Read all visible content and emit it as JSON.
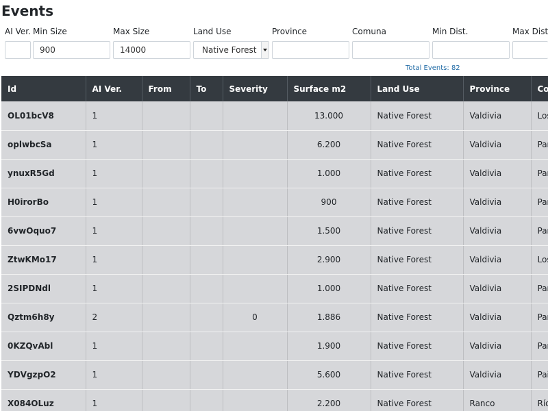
{
  "page": {
    "title": "Events"
  },
  "filters": {
    "ai_ver": {
      "label": "AI Ver.",
      "value": ""
    },
    "min_size": {
      "label": "Min Size",
      "value": "900"
    },
    "max_size": {
      "label": "Max Size",
      "value": "14000"
    },
    "land_use": {
      "label": "Land Use",
      "value": "Native Forest"
    },
    "province": {
      "label": "Province",
      "value": ""
    },
    "comuna": {
      "label": "Comuna",
      "value": ""
    },
    "min_dist": {
      "label": "Min Dist.",
      "value": ""
    },
    "max_dist": {
      "label": "Max Dist.",
      "value": ""
    }
  },
  "summary": {
    "total_events": "Total Events: 82"
  },
  "table": {
    "columns": [
      "Id",
      "AI Ver.",
      "From",
      "To",
      "Severity",
      "Surface m2",
      "Land Use",
      "Province",
      "Comuna"
    ],
    "rows": [
      {
        "id": "OL01bcV8",
        "ai_ver": "1",
        "from": "",
        "to": "",
        "severity": "",
        "surface": "13.000",
        "land_use": "Native Forest",
        "province": "Valdivia",
        "comuna": "Los"
      },
      {
        "id": "oplwbcSa",
        "ai_ver": "1",
        "from": "",
        "to": "",
        "severity": "",
        "surface": "6.200",
        "land_use": "Native Forest",
        "province": "Valdivia",
        "comuna": "Pan"
      },
      {
        "id": "ynuxR5Gd",
        "ai_ver": "1",
        "from": "",
        "to": "",
        "severity": "",
        "surface": "1.000",
        "land_use": "Native Forest",
        "province": "Valdivia",
        "comuna": "Pan"
      },
      {
        "id": "H0irorBo",
        "ai_ver": "1",
        "from": "",
        "to": "",
        "severity": "",
        "surface": "900",
        "land_use": "Native Forest",
        "province": "Valdivia",
        "comuna": "Pan"
      },
      {
        "id": "6vwOquo7",
        "ai_ver": "1",
        "from": "",
        "to": "",
        "severity": "",
        "surface": "1.500",
        "land_use": "Native Forest",
        "province": "Valdivia",
        "comuna": "Pan"
      },
      {
        "id": "ZtwKMo17",
        "ai_ver": "1",
        "from": "",
        "to": "",
        "severity": "",
        "surface": "2.900",
        "land_use": "Native Forest",
        "province": "Valdivia",
        "comuna": "Los"
      },
      {
        "id": "2SIPDNdl",
        "ai_ver": "1",
        "from": "",
        "to": "",
        "severity": "",
        "surface": "1.000",
        "land_use": "Native Forest",
        "province": "Valdivia",
        "comuna": "Pan"
      },
      {
        "id": "Qztm6h8y",
        "ai_ver": "2",
        "from": "",
        "to": "",
        "severity": "0",
        "surface": "1.886",
        "land_use": "Native Forest",
        "province": "Valdivia",
        "comuna": "Pan"
      },
      {
        "id": "0KZQvAbl",
        "ai_ver": "1",
        "from": "",
        "to": "",
        "severity": "",
        "surface": "1.900",
        "land_use": "Native Forest",
        "province": "Valdivia",
        "comuna": "Pan"
      },
      {
        "id": "YDVgzpO2",
        "ai_ver": "1",
        "from": "",
        "to": "",
        "severity": "",
        "surface": "5.600",
        "land_use": "Native Forest",
        "province": "Valdivia",
        "comuna": "Pai"
      },
      {
        "id": "X084OLuz",
        "ai_ver": "1",
        "from": "",
        "to": "",
        "severity": "",
        "surface": "2.200",
        "land_use": "Native Forest",
        "province": "Ranco",
        "comuna": "Río"
      }
    ]
  },
  "colors": {
    "header_bg": "#343a40",
    "row_bg": "#d6d7da",
    "accent_text": "#1f6aa5"
  }
}
